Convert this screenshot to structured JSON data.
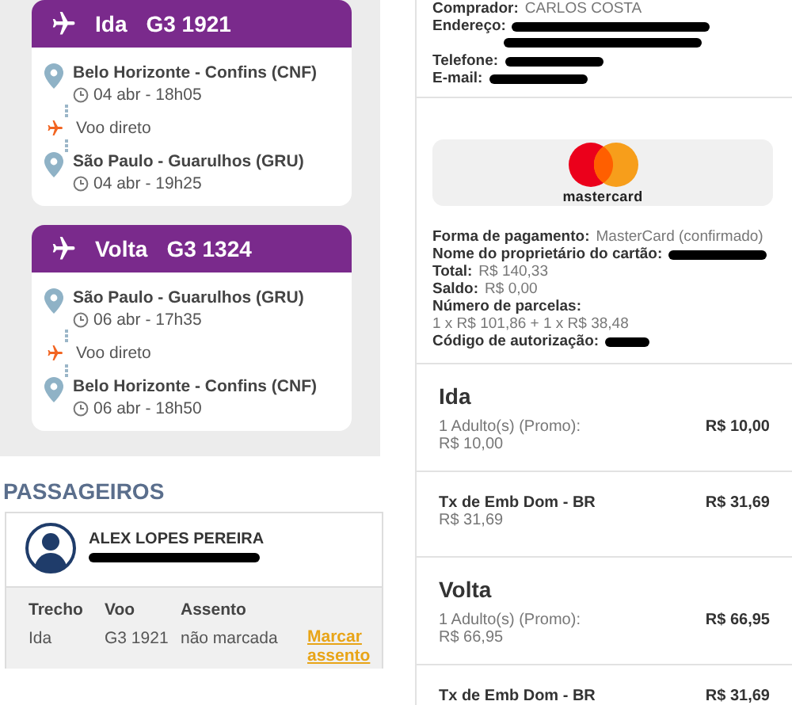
{
  "flights": [
    {
      "direction": "Ida",
      "number": "G3 1921",
      "departure": {
        "place": "Belo Horizonte - Confins (CNF)",
        "time": "04 abr - 18h05"
      },
      "segment": "Voo direto",
      "arrival": {
        "place": "São Paulo - Guarulhos (GRU)",
        "time": "04 abr - 19h25"
      }
    },
    {
      "direction": "Volta",
      "number": "G3 1324",
      "departure": {
        "place": "São Paulo - Guarulhos (GRU)",
        "time": "06 abr - 17h35"
      },
      "segment": "Voo direto",
      "arrival": {
        "place": "Belo Horizonte - Confins (CNF)",
        "time": "06 abr - 18h50"
      }
    }
  ],
  "passengers": {
    "title": "PASSAGEIROS",
    "items": [
      {
        "name": "ALEX LOPES PEREIRA",
        "columns": [
          "Trecho",
          "Voo",
          "Assento"
        ],
        "rows": [
          {
            "leg": "Ida",
            "flight": "G3 1921",
            "seat": "não marcada",
            "action": "Marcar assento"
          }
        ]
      }
    ]
  },
  "buyer": {
    "fields": [
      {
        "label": "Comprador:",
        "kind": "text",
        "value": "CARLOS COSTA"
      },
      {
        "label": "Endereço:",
        "kind": "redacted-long"
      },
      {
        "label": "Telefone:",
        "kind": "redacted"
      },
      {
        "label": "E-mail:",
        "kind": "redacted"
      }
    ]
  },
  "payment": {
    "card_brand": "mastercard",
    "fields": [
      {
        "label": "Forma de pagamento:",
        "kind": "text",
        "value": "MasterCard (confirmado)"
      },
      {
        "label": "Nome do proprietário do cartão:",
        "kind": "redacted"
      },
      {
        "label": "Total:",
        "kind": "text",
        "value": "R$ 140,33"
      },
      {
        "label": "Saldo:",
        "kind": "text",
        "value": "R$ 0,00"
      },
      {
        "label": "Número de parcelas:",
        "kind": "text",
        "value": "1 x R$ 101,86 + 1 x R$ 38,48"
      },
      {
        "label": "Código de autorização:",
        "kind": "redacted-short"
      }
    ]
  },
  "fares": [
    {
      "title": "Ida",
      "items": [
        {
          "kind": "fare",
          "label": "1 Adulto(s) (Promo):",
          "detail": "R$ 10,00",
          "amount": "R$ 10,00"
        },
        {
          "kind": "tax",
          "label": "Tx de Emb Dom - BR",
          "detail": "R$ 31,69",
          "amount": "R$ 31,69"
        }
      ]
    },
    {
      "title": "Volta",
      "items": [
        {
          "kind": "fare",
          "label": "1 Adulto(s) (Promo):",
          "detail": "R$ 66,95",
          "amount": "R$ 66,95"
        },
        {
          "kind": "tax",
          "label": "Tx de Emb Dom - BR",
          "amount": "R$ 31,69"
        }
      ]
    }
  ]
}
